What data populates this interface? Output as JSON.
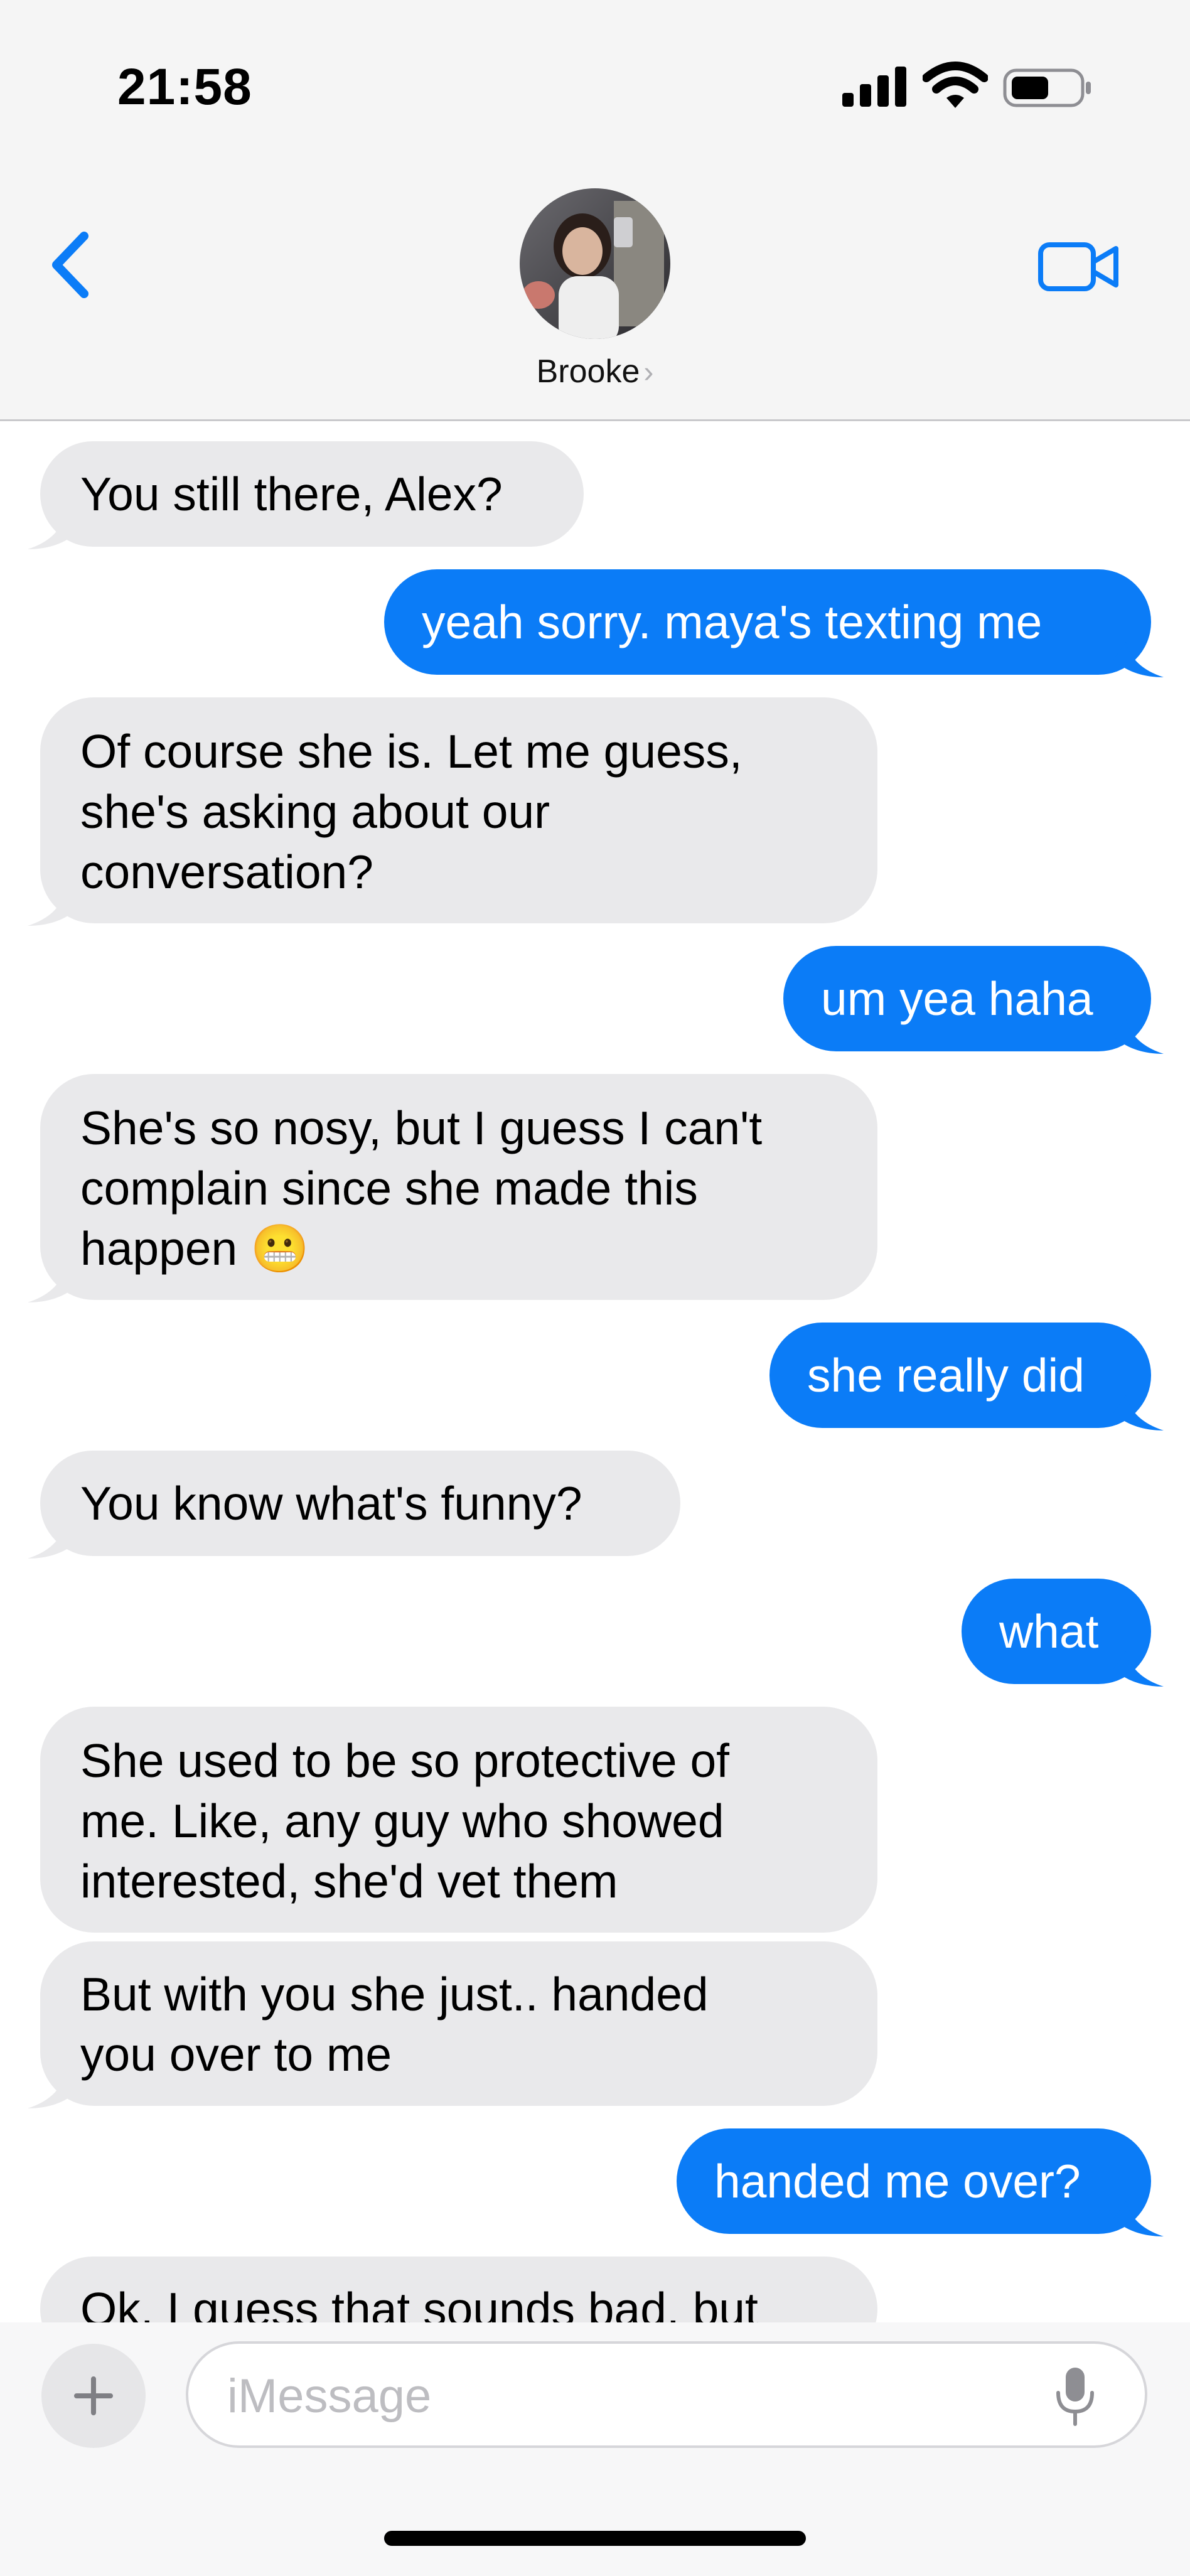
{
  "status_bar": {
    "time": "21:58",
    "icons": [
      "cellular-signal-icon",
      "wifi-icon",
      "battery-icon"
    ]
  },
  "header": {
    "contact_name": "Brooke",
    "chevron": "›",
    "back_icon": "chevron-left-icon",
    "video_icon": "video-camera-icon"
  },
  "messages": [
    {
      "direction": "in",
      "text": "You still there, Alex?"
    },
    {
      "direction": "out",
      "text": "yeah sorry. maya's texting me"
    },
    {
      "direction": "in",
      "lines": [
        "Of course she is. Let me guess,",
        "she's asking about our",
        "conversation?"
      ]
    },
    {
      "direction": "out",
      "text": "um yea haha"
    },
    {
      "direction": "in",
      "lines": [
        "She's so nosy, but I guess I can't",
        "complain since she made this",
        "happen 😬"
      ]
    },
    {
      "direction": "out",
      "text": "she really did"
    },
    {
      "direction": "in",
      "text": "You know what's funny?"
    },
    {
      "direction": "out",
      "text": "what"
    },
    {
      "direction": "in",
      "lines": [
        "She used to be so protective of",
        "me. Like, any guy who showed",
        "interested, she'd vet them"
      ]
    },
    {
      "direction": "in",
      "lines": [
        "But with you she just.. handed",
        "you over to me"
      ]
    },
    {
      "direction": "out",
      "text": "handed me over?"
    },
    {
      "direction": "in",
      "text": "Ok. I guess that sounds bad, but"
    }
  ],
  "composer": {
    "placeholder": "iMessage",
    "value": "",
    "plus_icon": "plus-icon",
    "mic_icon": "microphone-icon"
  },
  "colors": {
    "outgoing_bubble": "#0b7cf7",
    "incoming_bubble": "#e9e9eb",
    "accent": "#0b7cf7"
  }
}
